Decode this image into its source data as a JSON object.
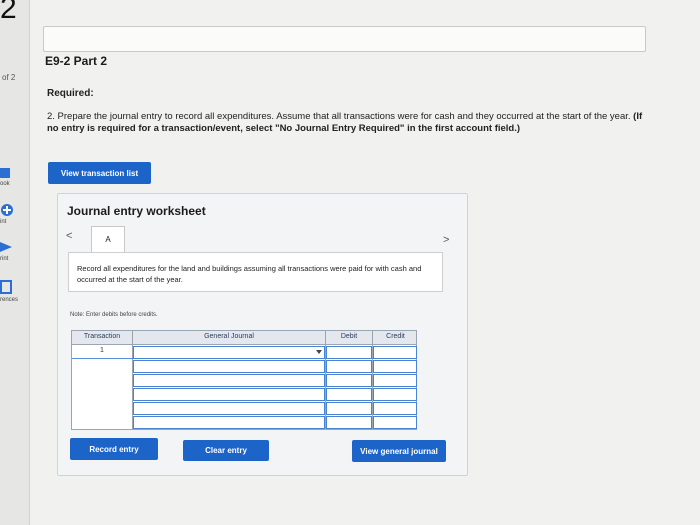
{
  "question": {
    "number": "2",
    "of_label": "of 2"
  },
  "sidebar": {
    "items": [
      {
        "label": "ook",
        "icon": "book-icon"
      },
      {
        "label": "int",
        "icon": "hint-icon"
      },
      {
        "label": "rint",
        "icon": "print-icon"
      },
      {
        "label": "rences",
        "icon": "references-icon"
      }
    ]
  },
  "header": {
    "part_title": "E9-2 Part 2",
    "required_label": "Required:",
    "instruction_plain": "2. Prepare the journal entry to record all expenditures. Assume that all transactions were for cash and they occurred at the start of the year.",
    "instruction_bold": "(If no entry is required for a transaction/event, select \"No Journal Entry Required\" in the first account field.)"
  },
  "buttons": {
    "view_transactions": "View transaction list",
    "record_entry": "Record entry",
    "clear_entry": "Clear entry",
    "view_general_journal": "View general journal"
  },
  "worksheet": {
    "title": "Journal entry worksheet",
    "prev_symbol": "<",
    "next_symbol": ">",
    "active_tab": "A",
    "description": "Record all expenditures for the land and buildings assuming all transactions were paid for with cash and occurred at the start of the year.",
    "note": "Note: Enter debits before credits."
  },
  "journal_table": {
    "columns": {
      "transaction": "Transaction",
      "general_journal": "General Journal",
      "debit": "Debit",
      "credit": "Credit"
    },
    "rows": [
      {
        "transaction": "1",
        "account": "",
        "debit": "",
        "credit": ""
      },
      {
        "transaction": "",
        "account": "",
        "debit": "",
        "credit": ""
      },
      {
        "transaction": "",
        "account": "",
        "debit": "",
        "credit": ""
      },
      {
        "transaction": "",
        "account": "",
        "debit": "",
        "credit": ""
      },
      {
        "transaction": "",
        "account": "",
        "debit": "",
        "credit": ""
      },
      {
        "transaction": "",
        "account": "",
        "debit": "",
        "credit": ""
      }
    ]
  },
  "colors": {
    "accent": "#1d64c9",
    "input_border": "#4a83d1"
  }
}
